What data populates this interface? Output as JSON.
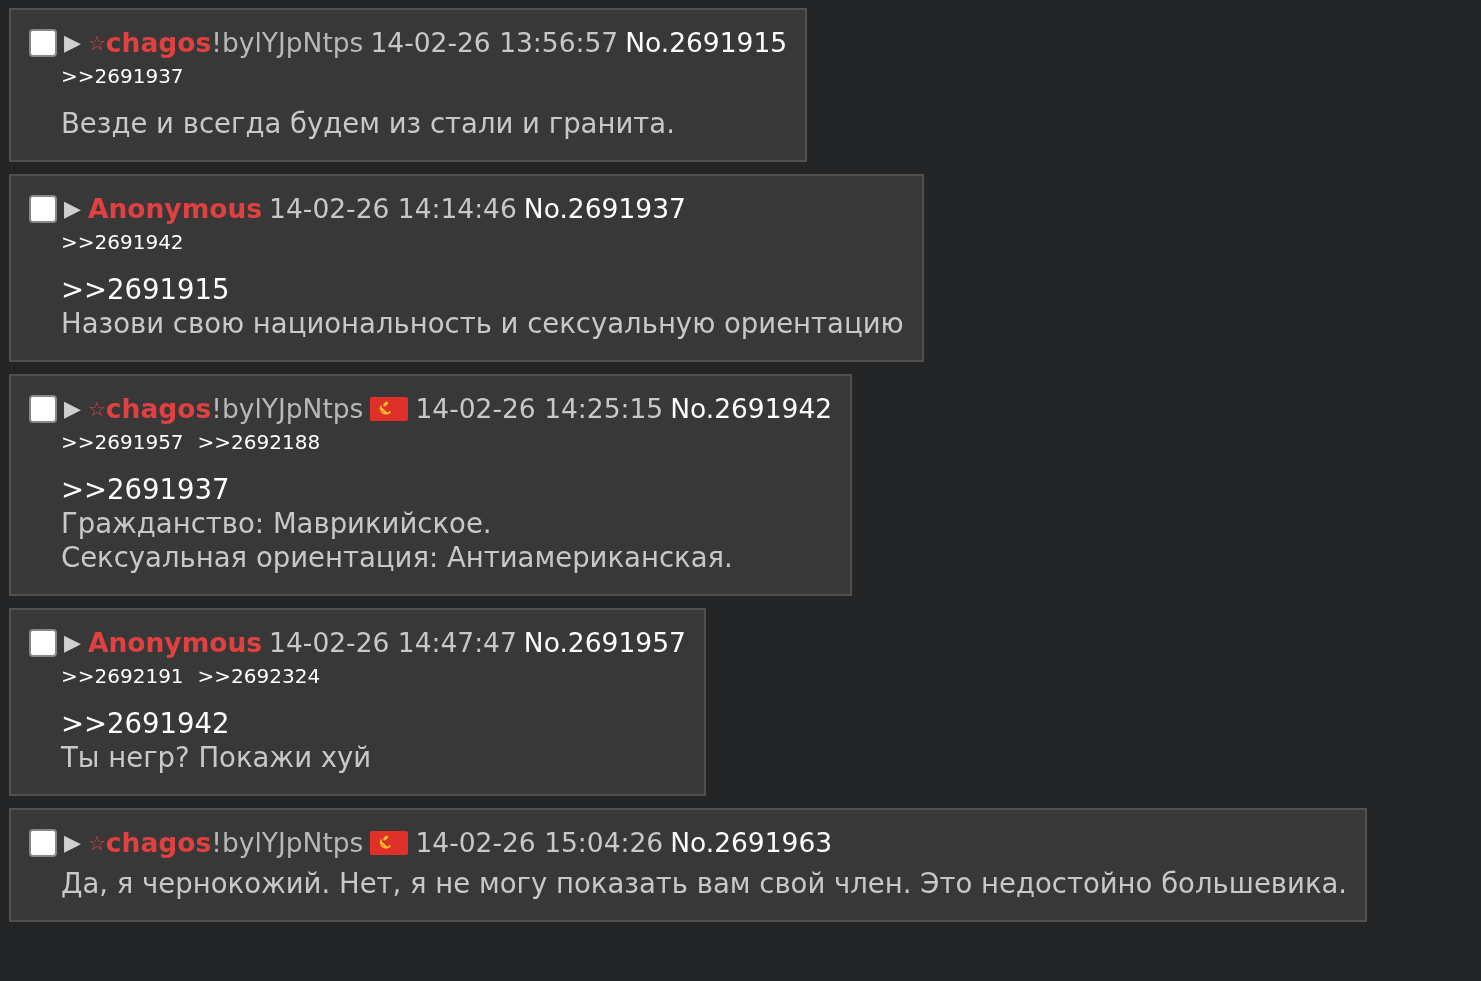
{
  "posts": [
    {
      "checked": false,
      "arrow": "▶",
      "star": "☆",
      "name": "chagos",
      "trip": "!bylYJpNtps",
      "date": "14-02-26 13:56:57",
      "number": "No.2691915",
      "replies": [
        ">>2691937"
      ],
      "lines": [
        "Везде и всегда будем из стали и гранита."
      ]
    },
    {
      "checked": false,
      "arrow": "▶",
      "name": "Anonymous",
      "date": "14-02-26 14:14:46",
      "number": "No.2691937",
      "replies": [
        ">>2691942"
      ],
      "quote": ">>2691915",
      "lines": [
        "Назови свою национальность и сексуальную ориентацию"
      ]
    },
    {
      "checked": false,
      "arrow": "▶",
      "star": "☆",
      "name": "chagos",
      "trip": "!bylYJpNtps",
      "flag": true,
      "date": "14-02-26 14:25:15",
      "number": "No.2691942",
      "replies": [
        ">>2691957",
        ">>2692188"
      ],
      "quote": ">>2691937",
      "lines": [
        "Гражданство: Маврикийское.",
        "Сексуальная ориентация: Антиамериканская."
      ]
    },
    {
      "checked": false,
      "arrow": "▶",
      "name": "Anonymous",
      "date": "14-02-26 14:47:47",
      "number": "No.2691957",
      "replies": [
        ">>2692191",
        ">>2692324"
      ],
      "quote": ">>2691942",
      "lines": [
        "Ты негр? Покажи хуй"
      ]
    },
    {
      "checked": false,
      "arrow": "▶",
      "star": "☆",
      "name": "chagos",
      "trip": "!bylYJpNtps",
      "flag": true,
      "date": "14-02-26 15:04:26",
      "number": "No.2691963",
      "lines": [
        "Да, я чернокожий. Нет, я не могу показать вам свой член. Это недостойно большевика."
      ]
    }
  ]
}
